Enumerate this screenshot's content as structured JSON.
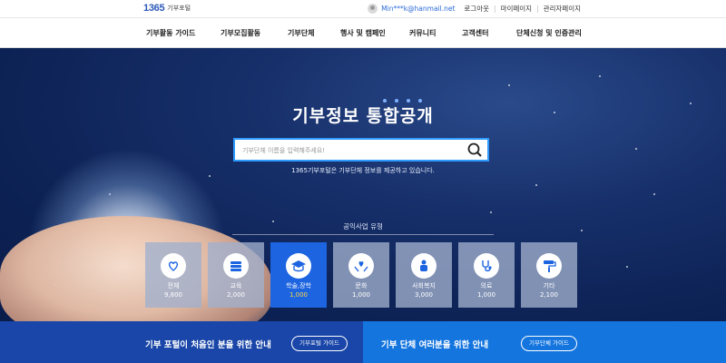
{
  "header": {
    "logo_number": "1365",
    "logo_text": "기부포털",
    "user_email": "Min***k@hanmail.net",
    "links": [
      "로그아웃",
      "마이페이지",
      "관리자페이지"
    ]
  },
  "nav": {
    "items": [
      "기부활동 가이드",
      "기부모집활동",
      "기부단체",
      "행사 및 캠페인",
      "커뮤니티",
      "고객센터",
      "단체신청 및 인증관리"
    ]
  },
  "hero": {
    "title": "기부정보 통합공개",
    "search_placeholder": "기부단체 이름을 입력해주세요!",
    "note": "1365기부포털은 기부단체 정보를 제공하고 있습니다.",
    "category_heading": "공익사업 유형",
    "categories": [
      {
        "name": "전체",
        "count": "9,800",
        "icon": "heart-hands-icon",
        "active": false
      },
      {
        "name": "교육",
        "count": "2,000",
        "icon": "books-icon",
        "active": false
      },
      {
        "name": "학술,장학",
        "count": "1,000",
        "icon": "graduation-cap-icon",
        "active": true
      },
      {
        "name": "문화",
        "count": "1,000",
        "icon": "hands-heart-icon",
        "active": false
      },
      {
        "name": "사회복지",
        "count": "3,000",
        "icon": "family-icon",
        "active": false
      },
      {
        "name": "의료",
        "count": "1,000",
        "icon": "stethoscope-icon",
        "active": false
      },
      {
        "name": "기타",
        "count": "2,100",
        "icon": "roller-icon",
        "active": false
      }
    ]
  },
  "banners": {
    "left_text": "기부 포털이 처음인 분을 위한 안내",
    "left_button": "기부포털 가이드",
    "right_text": "기부 단체 여러분을 위한 안내",
    "right_button": "기부단체 가이드"
  },
  "colors": {
    "accent": "#1c64e0",
    "search_border": "#2f9bff",
    "active_count": "#ffd84a",
    "banner_left": "#1946a8",
    "banner_right": "#1475df"
  }
}
